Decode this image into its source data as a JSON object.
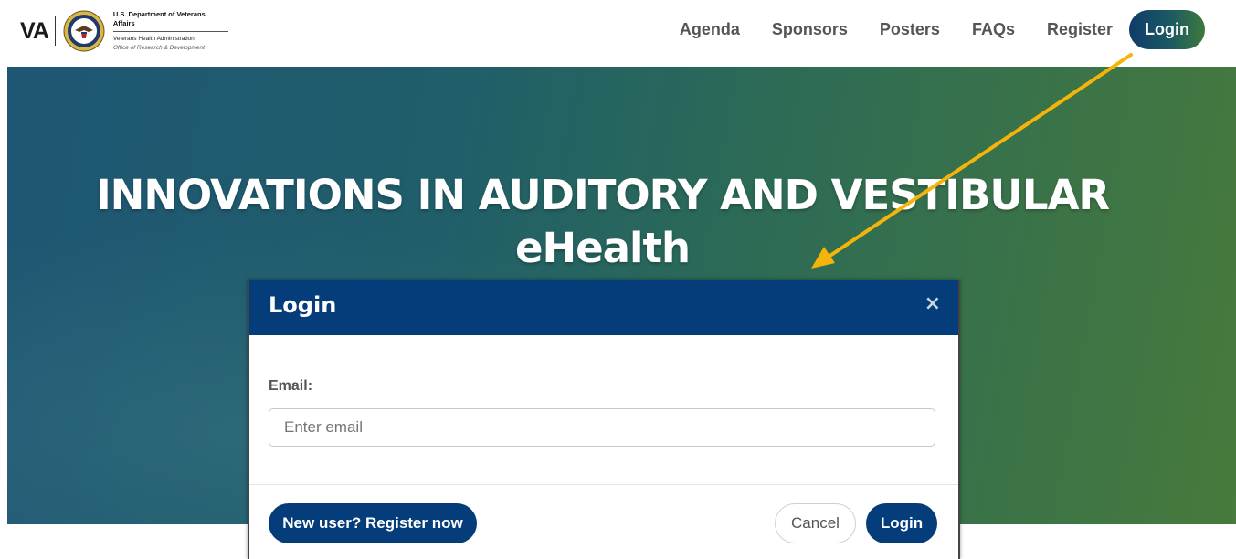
{
  "header": {
    "logo": {
      "mark": "VA",
      "line1": "U.S. Department of Veterans Affairs",
      "line2": "Veterans Health Administration",
      "line3": "Office of Research & Development",
      "seal_icon": "va-seal-icon"
    },
    "nav": [
      {
        "label": "Agenda"
      },
      {
        "label": "Sponsors"
      },
      {
        "label": "Posters"
      },
      {
        "label": "FAQs"
      },
      {
        "label": "Register"
      }
    ],
    "login_label": "Login"
  },
  "hero": {
    "title_line1": "INNOVATIONS IN AUDITORY AND VESTIBULAR",
    "title_line2": "eHealth"
  },
  "annotation": {
    "color": "#f5b40a"
  },
  "modal": {
    "title": "Login",
    "close_symbol": "×",
    "email_label": "Email:",
    "email_placeholder": "Enter email",
    "email_value": "",
    "register_label": "New user? Register now",
    "cancel_label": "Cancel",
    "login_label": "Login"
  },
  "colors": {
    "brand_blue": "#053d7a",
    "hero_start": "#1f5674",
    "hero_end": "#477a3c"
  }
}
